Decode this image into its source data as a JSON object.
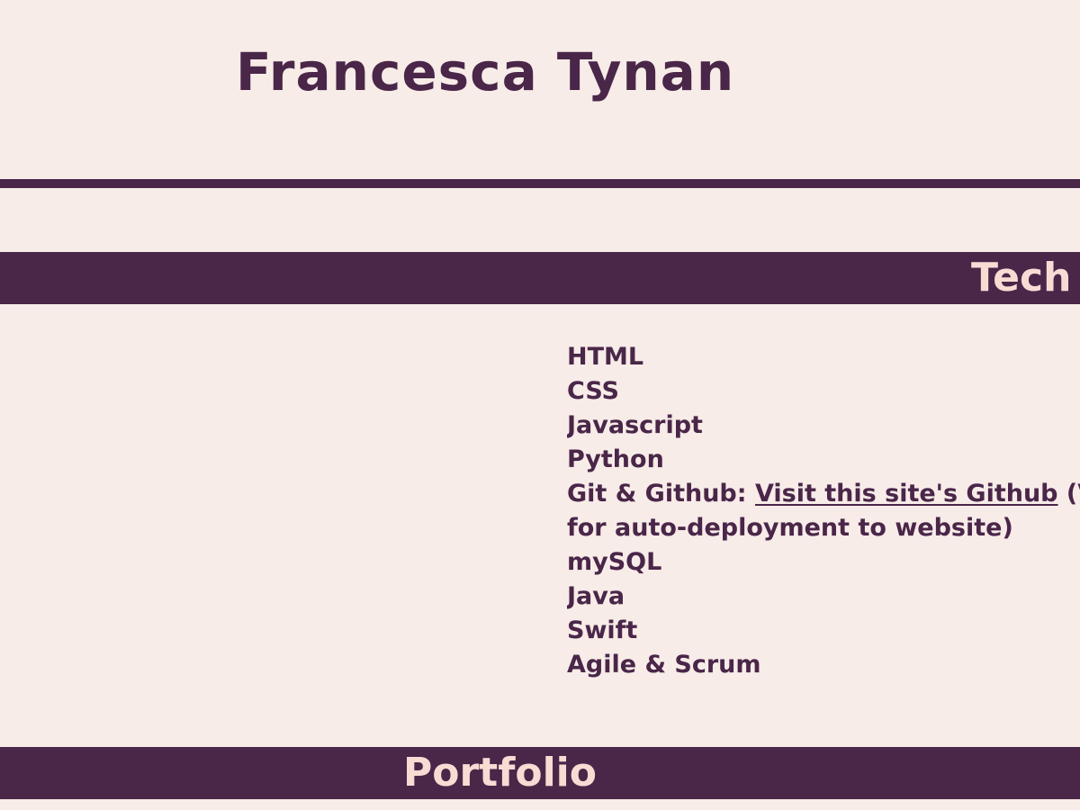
{
  "header": {
    "title": "Francesca Tynan"
  },
  "sections": {
    "tech_heading": "Tech",
    "portfolio_heading": "Portfolio"
  },
  "skills": {
    "items": [
      "HTML",
      "CSS",
      "Javascript",
      "Python"
    ],
    "git": {
      "prefix": "Git & Github: ",
      "link_text": "Visit this site's Github",
      "suffix": " (V",
      "continuation": "for auto-deployment to website)"
    },
    "more_items": [
      "mySQL",
      "Java",
      "Swift",
      "Agile & Scrum"
    ]
  },
  "colors": {
    "background": "#f7ece8",
    "accent": "#4a2649",
    "banner_text": "#f6dcd3"
  }
}
